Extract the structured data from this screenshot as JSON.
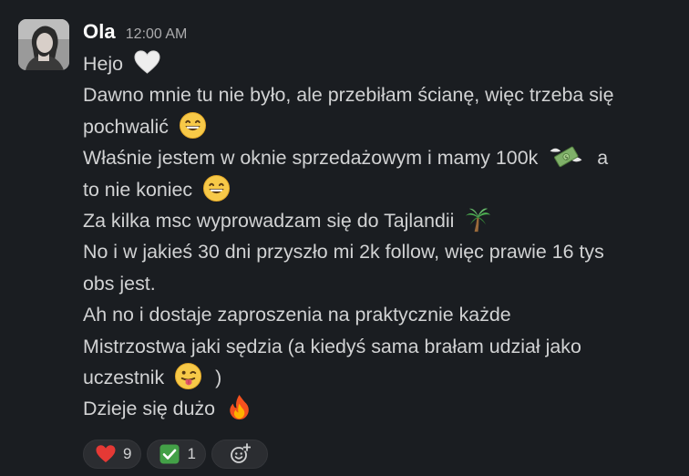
{
  "message": {
    "author": "Ola",
    "timestamp": "12:00 AM",
    "lines": [
      {
        "text": "Hejo",
        "emoji": "white-heart-icon"
      },
      {
        "text": "Dawno mnie tu nie było, ale przebiłam ścianę, więc trzeba się",
        "emoji": null
      },
      {
        "text": "pochwalić",
        "emoji": "grinning-face-icon"
      },
      {
        "text": "Właśnie jestem w oknie sprzedażowym i mamy 100k",
        "emoji": "money-with-wings-icon",
        "after": "a"
      },
      {
        "text": "to nie koniec",
        "emoji": "grinning-face-icon"
      },
      {
        "text": "Za kilka msc wyprowadzam się do Tajlandii",
        "emoji": "palm-tree-icon"
      },
      {
        "text": "No i w jakieś 30 dni przyszło mi 2k follow, więc prawie 16 tys",
        "emoji": null
      },
      {
        "text": "obs jest.",
        "emoji": null
      },
      {
        "text": "Ah no i dostaje zaproszenia na praktycznie każde",
        "emoji": null
      },
      {
        "text": "Mistrzostwa jaki sędzia (a kiedyś sama brałam udział jako",
        "emoji": null
      },
      {
        "text": "uczestnik",
        "emoji": "tongue-face-icon",
        "after": ")"
      },
      {
        "text": "Dzieje się dużo",
        "emoji": "fire-icon"
      }
    ]
  },
  "reactions": [
    {
      "emoji": "red-heart-icon",
      "count": "9"
    },
    {
      "emoji": "check-mark-button-icon",
      "count": "1"
    }
  ],
  "add_reaction": {
    "icon": "add-reaction-icon"
  },
  "colors": {
    "background": "#1a1d21",
    "text": "#d1d2d3",
    "author": "#ffffff",
    "timestamp": "#ababad",
    "reaction_bg": "#2b2d31"
  }
}
